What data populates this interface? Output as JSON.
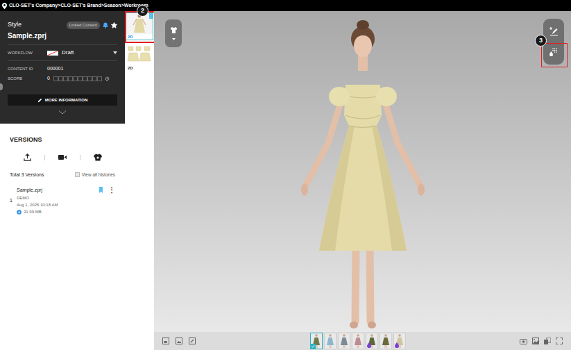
{
  "breadcrumb": "CLO-SET's Company>CLO-SET's Brand>Season>Workroom",
  "style": {
    "label": "Style",
    "badge": "Linked Content",
    "subscribed": true,
    "favorite": true,
    "name": "Sample.zprj"
  },
  "workflow": {
    "label": "WORKFLOW",
    "value": "Draft"
  },
  "content_id": {
    "label": "CONTENT ID",
    "value": "000001"
  },
  "score": {
    "label": "SCORE",
    "value": "0",
    "stars": 0
  },
  "more_button": "MORE INFORMATION",
  "versions": {
    "title": "VERSIONS",
    "total": "Total 3 Versions",
    "view_all": {
      "label": "View all histories",
      "checked": false
    },
    "items": [
      {
        "index": "1",
        "name": "Sample.zprj",
        "author": "DEMO",
        "date": "Aug 1, 2025 10:18 AM",
        "size": "31.99 MB",
        "menu": "⋮"
      }
    ]
  },
  "thumbnails": [
    {
      "label": "2D",
      "selected": true
    },
    {
      "label": "2D",
      "selected": false
    }
  ],
  "annotations": [
    {
      "label": "2"
    },
    {
      "label": "3"
    }
  ],
  "colorways": [
    {
      "color": "#6f7a4a",
      "selected": true,
      "has_drop": false
    },
    {
      "color": "#8fb6cf",
      "selected": false,
      "has_drop": false
    },
    {
      "color": "#7d8a98",
      "selected": false,
      "has_drop": false
    },
    {
      "color": "#c08c93",
      "selected": false,
      "has_drop": false
    },
    {
      "color": "#5c6838",
      "selected": false,
      "has_drop": true
    },
    {
      "color": "#6b6a3c",
      "selected": false,
      "has_drop": false
    },
    {
      "color": "#cfc59c",
      "selected": false,
      "has_drop": true
    }
  ]
}
